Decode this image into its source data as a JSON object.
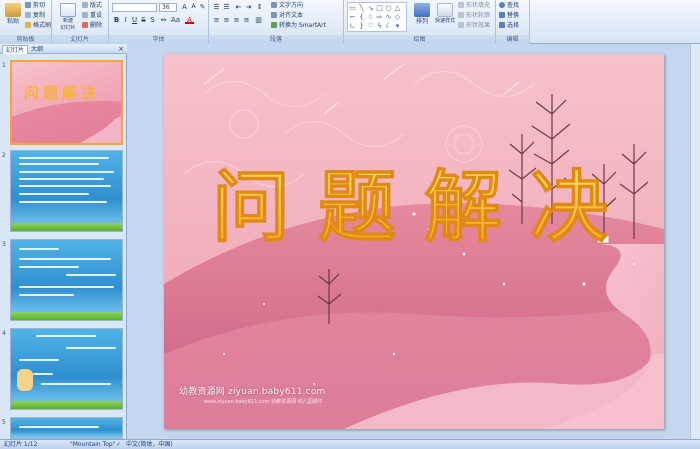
{
  "ribbon": {
    "clipboard": {
      "paste": "粘贴",
      "cut": "剪切",
      "copy": "复制",
      "format_painter": "格式刷",
      "label": "剪贴板"
    },
    "slides": {
      "new_slide": "新建\n幻灯片",
      "layout": "版式",
      "reset": "重设",
      "delete": "删除",
      "label": "幻灯片"
    },
    "font": {
      "size": "36",
      "label": "字体"
    },
    "paragraph": {
      "text_direction": "文字方向",
      "align_text": "对齐文本",
      "smartart": "转换为 SmartArt",
      "label": "段落"
    },
    "drawing": {
      "arrange": "排列",
      "quick_styles": "快速样式",
      "shape_fill": "形状填充",
      "shape_outline": "形状轮廓",
      "shape_effects": "形状效果",
      "label": "绘图"
    },
    "editing": {
      "find": "查找",
      "replace": "替换",
      "select": "选择",
      "label": "编辑"
    }
  },
  "left_panel": {
    "tab_slides": "幻灯片",
    "tab_outline": "大纲",
    "close": "×",
    "slide_numbers": [
      "1",
      "2",
      "3",
      "4",
      "5"
    ],
    "thumb1_title": "问题解决"
  },
  "slide": {
    "title": "问题解决",
    "watermark": "幼教资源网 ziyuan.baby611.com",
    "watermark_sub": "www.ziyuan.baby611.com 幼教资源网 幼儿园课件"
  },
  "status": {
    "slide_info": "幻灯片 1/12",
    "theme": "\"Mountain Top\"",
    "language": "中文(简体，中国)"
  },
  "colors": {
    "title_top": "#ffe36a",
    "title_bottom": "#f7a21c",
    "slide_bg": "#f3aab8"
  }
}
